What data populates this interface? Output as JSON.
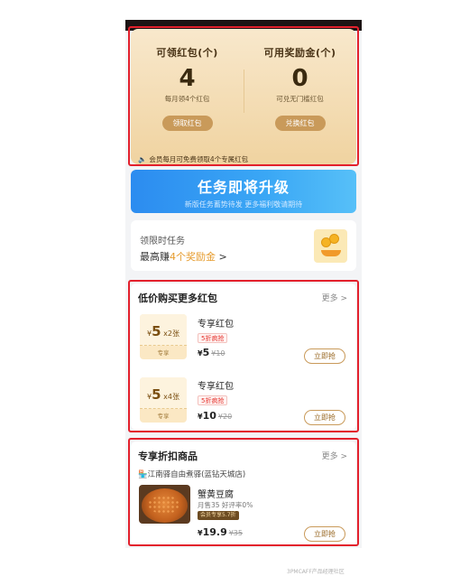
{
  "redpacket": {
    "left": {
      "title": "可领红包(个)",
      "count": "4",
      "note": "每月领4个红包",
      "button": "领取红包"
    },
    "right": {
      "title": "可用奖励金(个)",
      "count": "0",
      "note": "可兑无门槛红包",
      "button": "兑换红包"
    },
    "notice": "会员每月可免费领取4个专属红包"
  },
  "banner": {
    "title": "任务即将升级",
    "subtitle": "新版任务蓄势待发 更多福利敬请期待"
  },
  "task": {
    "label": "领限时任务",
    "earn_prefix": "最高赚",
    "earn_highlight": "4个奖励金",
    "earn_suffix": " >"
  },
  "cheap_section": {
    "title": "低价购买更多红包",
    "more": "更多 >",
    "items": [
      {
        "voucher_amount": "5",
        "voucher_mult": "x2张",
        "voucher_label": "专享",
        "name": "专享红包",
        "tag": "5折疯抢",
        "price": "5",
        "old_price": "¥10",
        "button": "立即抢"
      },
      {
        "voucher_amount": "5",
        "voucher_mult": "x4张",
        "voucher_label": "专享",
        "name": "专享红包",
        "tag": "5折疯抢",
        "price": "10",
        "old_price": "¥20",
        "button": "立即抢"
      }
    ]
  },
  "discount_section": {
    "title": "专享折扣商品",
    "more": "更多 >",
    "shop": "江南驿自由煮驿(蓝钻天城店)",
    "product": {
      "name": "蟹黄豆腐",
      "sales": "月售35  好评率0%",
      "member_tag": "会员专享5.7折",
      "price": "19.9",
      "old_price": "¥35",
      "button": "立即抢"
    }
  },
  "currency_symbol": "¥",
  "watermark": "3PMCAFF产品经理社区"
}
